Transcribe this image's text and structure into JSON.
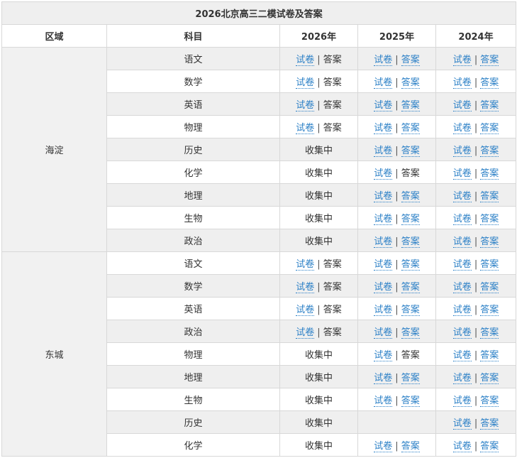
{
  "title": "2026北京高三二模试卷及答案",
  "headers": [
    "区域",
    "科目",
    "2026年",
    "2025年",
    "2024年"
  ],
  "regions": [
    {
      "name": "海淀",
      "rows": [
        {
          "subject": "语文",
          "c2026": {
            "type": "links",
            "paper": "试卷",
            "answer": "答案",
            "answer_link": false
          },
          "c2025": {
            "type": "links",
            "paper": "试卷",
            "answer": "答案",
            "answer_link": true
          },
          "c2024": {
            "type": "links",
            "paper": "试卷",
            "answer": "答案",
            "answer_link": true
          }
        },
        {
          "subject": "数学",
          "c2026": {
            "type": "links",
            "paper": "试卷",
            "answer": "答案",
            "answer_link": false
          },
          "c2025": {
            "type": "links",
            "paper": "试卷",
            "answer": "答案",
            "answer_link": true
          },
          "c2024": {
            "type": "links",
            "paper": "试卷",
            "answer": "答案",
            "answer_link": true
          }
        },
        {
          "subject": "英语",
          "c2026": {
            "type": "links",
            "paper": "试卷",
            "answer": "答案",
            "answer_link": false
          },
          "c2025": {
            "type": "links",
            "paper": "试卷",
            "answer": "答案",
            "answer_link": true
          },
          "c2024": {
            "type": "links",
            "paper": "试卷",
            "answer": "答案",
            "answer_link": true
          }
        },
        {
          "subject": "物理",
          "c2026": {
            "type": "links",
            "paper": "试卷",
            "answer": "答案",
            "answer_link": false
          },
          "c2025": {
            "type": "links",
            "paper": "试卷",
            "answer": "答案",
            "answer_link": true
          },
          "c2024": {
            "type": "links",
            "paper": "试卷",
            "answer": "答案",
            "answer_link": true
          }
        },
        {
          "subject": "历史",
          "c2026": {
            "type": "status",
            "text": "收集中"
          },
          "c2025": {
            "type": "links",
            "paper": "试卷",
            "answer": "答案",
            "answer_link": true
          },
          "c2024": {
            "type": "links",
            "paper": "试卷",
            "answer": "答案",
            "answer_link": true
          }
        },
        {
          "subject": "化学",
          "c2026": {
            "type": "status",
            "text": "收集中"
          },
          "c2025": {
            "type": "links",
            "paper": "试卷",
            "answer": "答案",
            "answer_link": false
          },
          "c2024": {
            "type": "links",
            "paper": "试卷",
            "answer": "答案",
            "answer_link": true
          }
        },
        {
          "subject": "地理",
          "c2026": {
            "type": "status",
            "text": "收集中"
          },
          "c2025": {
            "type": "links",
            "paper": "试卷",
            "answer": "答案",
            "answer_link": true
          },
          "c2024": {
            "type": "links",
            "paper": "试卷",
            "answer": "答案",
            "answer_link": true
          }
        },
        {
          "subject": "生物",
          "c2026": {
            "type": "status",
            "text": "收集中"
          },
          "c2025": {
            "type": "links",
            "paper": "试卷",
            "answer": "答案",
            "answer_link": true
          },
          "c2024": {
            "type": "links",
            "paper": "试卷",
            "answer": "答案",
            "answer_link": true
          }
        },
        {
          "subject": "政治",
          "c2026": {
            "type": "status",
            "text": "收集中"
          },
          "c2025": {
            "type": "links",
            "paper": "试卷",
            "answer": "答案",
            "answer_link": true
          },
          "c2024": {
            "type": "links",
            "paper": "试卷",
            "answer": "答案",
            "answer_link": true
          }
        }
      ]
    },
    {
      "name": "东城",
      "rows": [
        {
          "subject": "语文",
          "c2026": {
            "type": "links",
            "paper": "试卷",
            "answer": "答案",
            "answer_link": false
          },
          "c2025": {
            "type": "links",
            "paper": "试卷",
            "answer": "答案",
            "answer_link": true
          },
          "c2024": {
            "type": "links",
            "paper": "试卷",
            "answer": "答案",
            "answer_link": true
          }
        },
        {
          "subject": "数学",
          "c2026": {
            "type": "links",
            "paper": "试卷",
            "answer": "答案",
            "answer_link": false
          },
          "c2025": {
            "type": "links",
            "paper": "试卷",
            "answer": "答案",
            "answer_link": true
          },
          "c2024": {
            "type": "links",
            "paper": "试卷",
            "answer": "答案",
            "answer_link": true
          }
        },
        {
          "subject": "英语",
          "c2026": {
            "type": "links",
            "paper": "试卷",
            "answer": "答案",
            "answer_link": false
          },
          "c2025": {
            "type": "links",
            "paper": "试卷",
            "answer": "答案",
            "answer_link": true
          },
          "c2024": {
            "type": "links",
            "paper": "试卷",
            "answer": "答案",
            "answer_link": true
          }
        },
        {
          "subject": "政治",
          "c2026": {
            "type": "links",
            "paper": "试卷",
            "answer": "答案",
            "answer_link": false
          },
          "c2025": {
            "type": "links",
            "paper": "试卷",
            "answer": "答案",
            "answer_link": true
          },
          "c2024": {
            "type": "links",
            "paper": "试卷",
            "answer": "答案",
            "answer_link": true
          }
        },
        {
          "subject": "物理",
          "c2026": {
            "type": "status",
            "text": "收集中"
          },
          "c2025": {
            "type": "links",
            "paper": "试卷",
            "answer": "答案",
            "answer_link": false
          },
          "c2024": {
            "type": "links",
            "paper": "试卷",
            "answer": "答案",
            "answer_link": true
          }
        },
        {
          "subject": "地理",
          "c2026": {
            "type": "status",
            "text": "收集中"
          },
          "c2025": {
            "type": "links",
            "paper": "试卷",
            "answer": "答案",
            "answer_link": true
          },
          "c2024": {
            "type": "links",
            "paper": "试卷",
            "answer": "答案",
            "answer_link": true
          }
        },
        {
          "subject": "生物",
          "c2026": {
            "type": "status",
            "text": "收集中"
          },
          "c2025": {
            "type": "links",
            "paper": "试卷",
            "answer": "答案",
            "answer_link": true
          },
          "c2024": {
            "type": "links",
            "paper": "试卷",
            "answer": "答案",
            "answer_link": true
          }
        },
        {
          "subject": "历史",
          "c2026": {
            "type": "status",
            "text": "收集中"
          },
          "c2025": {
            "type": "empty"
          },
          "c2024": {
            "type": "links",
            "paper": "试卷",
            "answer": "答案",
            "answer_link": true
          }
        },
        {
          "subject": "化学",
          "c2026": {
            "type": "status",
            "text": "收集中"
          },
          "c2025": {
            "type": "links",
            "paper": "试卷",
            "answer": "答案",
            "answer_link": true
          },
          "c2024": {
            "type": "links",
            "paper": "试卷",
            "answer": "答案",
            "answer_link": true
          }
        }
      ]
    }
  ],
  "separator": "|",
  "colors": {
    "link": "#2a7fc6",
    "shade": "#efefef",
    "region_bg": "#f1f1f1",
    "border": "#d8d8d8"
  }
}
